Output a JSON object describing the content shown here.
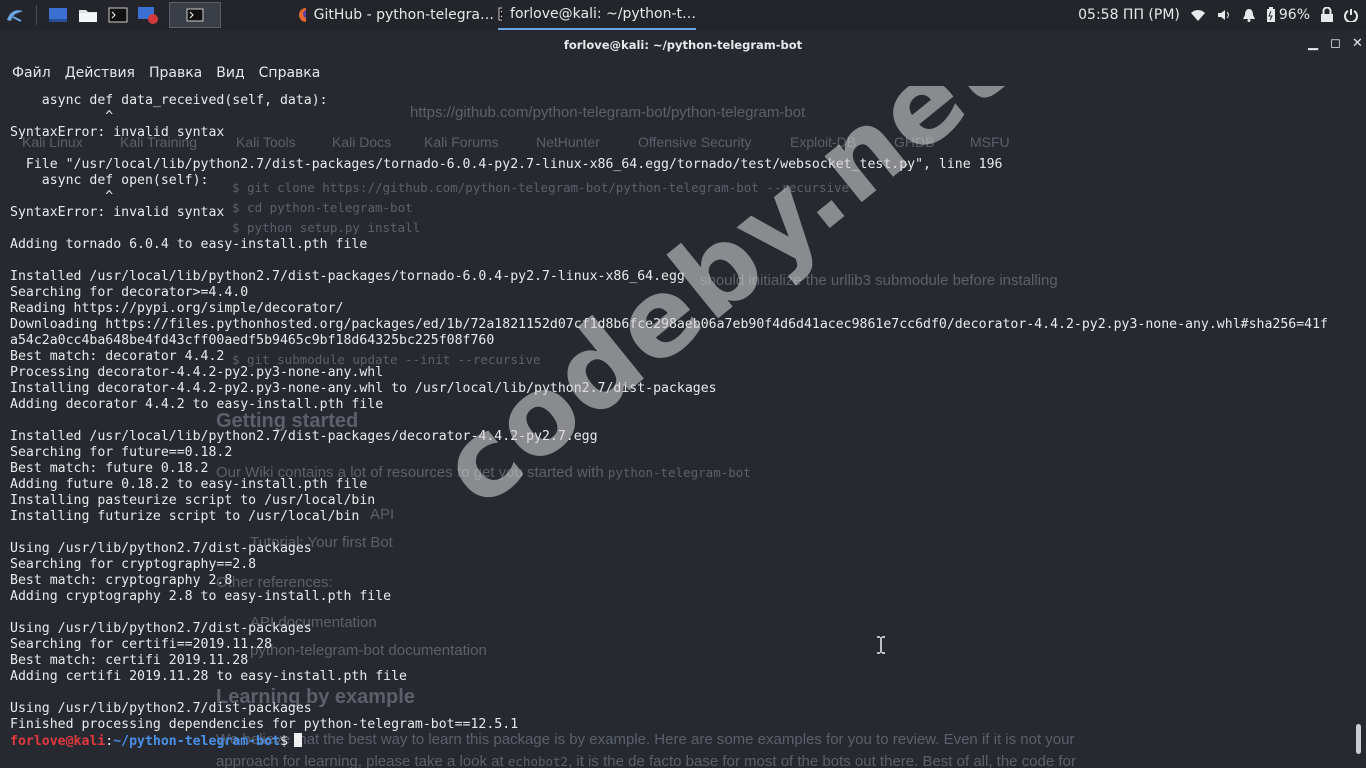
{
  "taskbar": {
    "tasks": [
      {
        "label": "GitHub - python-telegra…",
        "icon": "firefox-icon"
      },
      {
        "label": "forlove@kali: ~/python-t…",
        "icon": "terminal-icon"
      }
    ],
    "clock": "05:58 ПП (PM)",
    "battery": "96%"
  },
  "window": {
    "title": "forlove@kali: ~/python-telegram-bot"
  },
  "menu": [
    "Файл",
    "Действия",
    "Правка",
    "Вид",
    "Справка"
  ],
  "terminal": {
    "lines": [
      "    async def data_received(self, data):",
      "            ^",
      "SyntaxError: invalid syntax",
      "",
      "  File \"/usr/local/lib/python2.7/dist-packages/tornado-6.0.4-py2.7-linux-x86_64.egg/tornado/test/websocket_test.py\", line 196",
      "    async def open(self):",
      "            ^",
      "SyntaxError: invalid syntax",
      "",
      "Adding tornado 6.0.4 to easy-install.pth file",
      "",
      "Installed /usr/local/lib/python2.7/dist-packages/tornado-6.0.4-py2.7-linux-x86_64.egg",
      "Searching for decorator>=4.4.0",
      "Reading https://pypi.org/simple/decorator/",
      "Downloading https://files.pythonhosted.org/packages/ed/1b/72a1821152d07cf1d8b6fce298aeb06a7eb90f4d6d41acec9861e7cc6df0/decorator-4.4.2-py2.py3-none-any.whl#sha256=41f",
      "a54c2a0cc4ba648be4fd43cff00aedf5b9465c9bf18d64325bc225f08f760",
      "Best match: decorator 4.4.2",
      "Processing decorator-4.4.2-py2.py3-none-any.whl",
      "Installing decorator-4.4.2-py2.py3-none-any.whl to /usr/local/lib/python2.7/dist-packages",
      "Adding decorator 4.4.2 to easy-install.pth file",
      "",
      "Installed /usr/local/lib/python2.7/dist-packages/decorator-4.4.2-py2.7.egg",
      "Searching for future==0.18.2",
      "Best match: future 0.18.2",
      "Adding future 0.18.2 to easy-install.pth file",
      "Installing pasteurize script to /usr/local/bin",
      "Installing futurize script to /usr/local/bin",
      "",
      "Using /usr/lib/python2.7/dist-packages",
      "Searching for cryptography==2.8",
      "Best match: cryptography 2.8",
      "Adding cryptography 2.8 to easy-install.pth file",
      "",
      "Using /usr/lib/python2.7/dist-packages",
      "Searching for certifi==2019.11.28",
      "Best match: certifi 2019.11.28",
      "Adding certifi 2019.11.28 to easy-install.pth file",
      "",
      "Using /usr/lib/python2.7/dist-packages",
      "Finished processing dependencies for python-telegram-bot==12.5.1"
    ],
    "prompt_user": "forlove@kali",
    "prompt_sep": ":",
    "prompt_path": "~/python-telegram-bot",
    "prompt_symbol": "$"
  },
  "background_page": {
    "url": "https://github.com/python-telegram-bot/python-telegram-bot",
    "bookmarks": [
      "Kali Linux",
      "Kali Training",
      "Kali Tools",
      "Kali Docs",
      "Kali Forums",
      "NetHunter",
      "Offensive Security",
      "Exploit-DB",
      "GHDB",
      "MSFU"
    ],
    "cmd1": "$ git clone https://github.com/python-telegram-bot/python-telegram-bot --recursive",
    "cmd2": "$ cd python-telegram-bot",
    "cmd3": "$ python setup.py install",
    "note": "should initialize the urllib3 submodule before installing",
    "cmd4": "$ git submodule update --init --recursive",
    "heading1": "Getting started",
    "text1": "Our Wiki contains a lot of resources to get you started with",
    "code1": "python-telegram-bot",
    "item_api": "API",
    "item_tutorial": "Tutorial: Your first Bot",
    "other_refs": "Other references:",
    "item_docs": "API documentation",
    "item_ptb_docs": "python-telegram-bot documentation",
    "heading2": "Learning by example",
    "text2": "We believe that the best way to learn this package is by example. Here are some examples for you to review. Even if it is not your",
    "text3": "approach for learning, please take a look at",
    "code2": "echobot2",
    "text4": ", it is the de facto base for most of the bots out there. Best of all, the code for"
  },
  "watermark": "codeby.net",
  "colors": {
    "background": "#262a30",
    "prompt_user": "#e0383e",
    "prompt_path": "#4a8fe8",
    "text": "#e9eaec"
  }
}
